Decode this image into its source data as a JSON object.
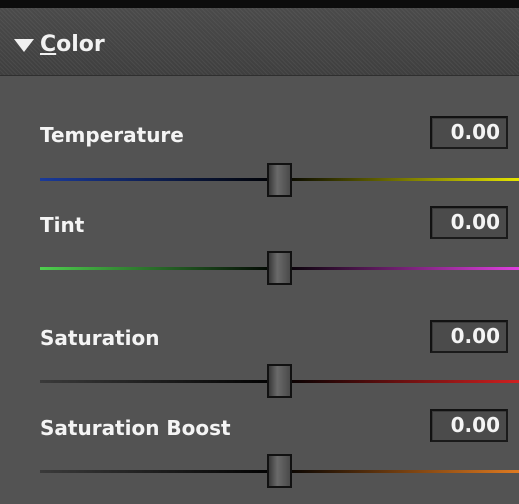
{
  "header": {
    "title_mnemonic": "C",
    "title_rest": "olor",
    "icon": "disclosure-triangle-down-icon"
  },
  "sliders": [
    {
      "label": "Temperature",
      "value": "0.00",
      "position_fraction": 0.5,
      "track_colors": [
        "#1a3a9a",
        "#000000",
        "#e6e600"
      ]
    },
    {
      "label": "Tint",
      "value": "0.00",
      "position_fraction": 0.5,
      "track_colors": [
        "#4fd04f",
        "#000000",
        "#e040e0"
      ]
    },
    {
      "label": "Saturation",
      "value": "0.00",
      "position_fraction": 0.5,
      "track_colors": [
        "#3a3a3a",
        "#000000",
        "#d02020"
      ]
    },
    {
      "label": "Saturation Boost",
      "value": "0.00",
      "position_fraction": 0.5,
      "track_colors": [
        "#3a3a3a",
        "#000000",
        "#e07a20"
      ]
    }
  ]
}
